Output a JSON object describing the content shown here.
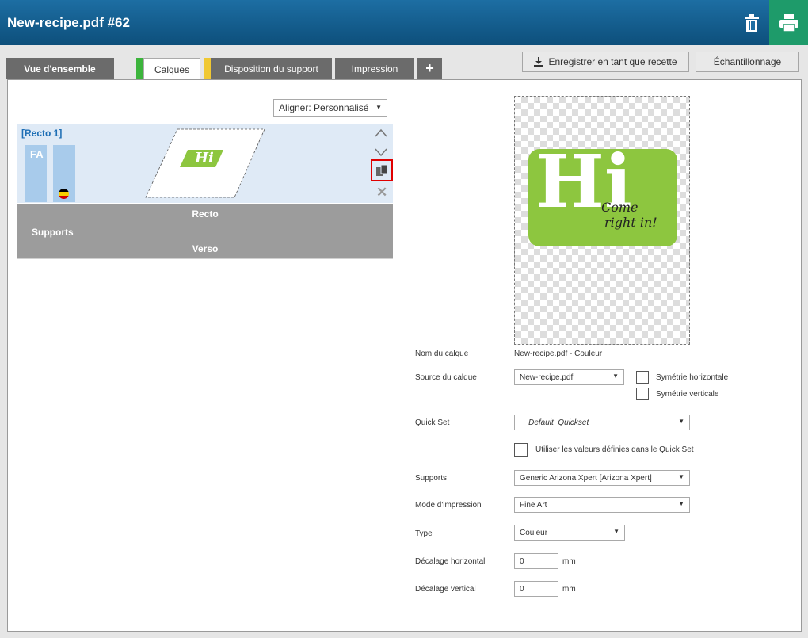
{
  "title": "New-recipe.pdf #62",
  "tabs": {
    "overview": "Vue d'ensemble",
    "layers": "Calques",
    "media_layout": "Disposition du support",
    "print": "Impression",
    "add": "+"
  },
  "buttons": {
    "save_recipe": "Enregistrer en tant que recette",
    "sampling": "Échantillonnage"
  },
  "align": {
    "value": "Aligner: Personnalisé"
  },
  "layer_card": {
    "name": "[Recto 1]",
    "badge": "FA",
    "preview_text": "Hi"
  },
  "supports": {
    "label": "Supports",
    "recto": "Recto",
    "verso": "Verso"
  },
  "preview": {
    "big_text": "Hi",
    "script_line1": "Come",
    "script_line2": "right in!"
  },
  "form": {
    "layer_name_label": "Nom du calque",
    "layer_name_value": "New-recipe.pdf - Couleur",
    "layer_source_label": "Source du calque",
    "layer_source_value": "New-recipe.pdf",
    "flip_h": "Symétrie horizontale",
    "flip_v": "Symétrie verticale",
    "quickset_label": "Quick Set",
    "quickset_value": "__Default_Quickset__",
    "use_quickset": "Utiliser les valeurs définies dans le Quick Set",
    "media_label": "Supports",
    "media_value": "Generic Arizona Xpert [Arizona Xpert]",
    "print_mode_label": "Mode d'impression",
    "print_mode_value": "Fine Art",
    "type_label": "Type",
    "type_value": "Couleur",
    "h_offset_label": "Décalage horizontal",
    "h_offset_value": "0",
    "v_offset_label": "Décalage vertical",
    "v_offset_value": "0",
    "unit": "mm"
  },
  "colors": {
    "title_bar": "#1d6ea3",
    "print_button": "#1e9b6a",
    "layers_stripe": "#3cb43c",
    "media_stripe": "#f0c832",
    "logo_green": "#8dc63f",
    "highlight": "#e00000"
  }
}
